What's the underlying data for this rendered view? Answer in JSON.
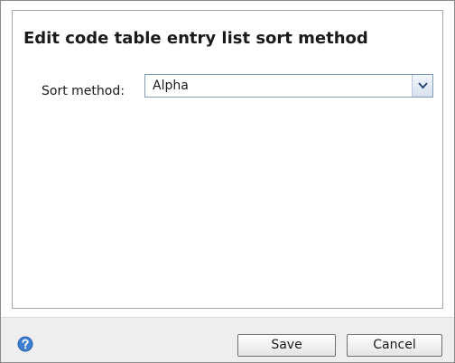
{
  "dialog": {
    "title": "Edit code table entry list sort method"
  },
  "form": {
    "sort_method_label": "Sort method:",
    "sort_method_value": "Alpha"
  },
  "footer": {
    "help_icon": "help-icon",
    "save_label": "Save",
    "cancel_label": "Cancel"
  },
  "colors": {
    "footer_background": "#eeeeee",
    "help_icon_blue": "#2d67b5"
  }
}
